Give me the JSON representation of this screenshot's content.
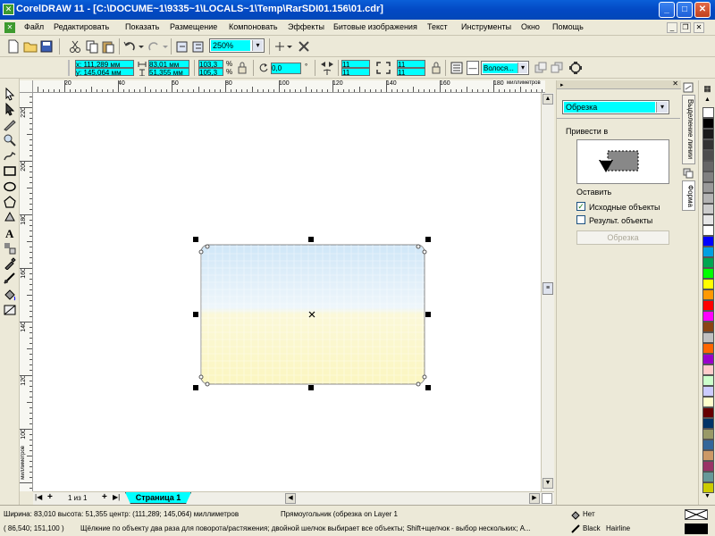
{
  "window": {
    "title": "CorelDRAW 11 - [C:\\DOCUME~1\\9335~1\\LOCALS~1\\Temp\\RarSDI01.156\\01.cdr]"
  },
  "menu": [
    "Файл",
    "Редактировать",
    "Показать",
    "Размещение",
    "Компоновать",
    "Эффекты",
    "Битовые изображения",
    "Текст",
    "Инструменты",
    "Окно",
    "Помощь"
  ],
  "toolbar": {
    "zoom": "250%"
  },
  "propbar": {
    "x": "x: 111,289 мм",
    "y": "y: 145,064 мм",
    "width": "83,01 мм",
    "height": "51,355 мм",
    "scale_x": "103,3",
    "scale_y": "105,3",
    "pct1": "%",
    "pct2": "%",
    "rotation": "0,0",
    "deg": "°",
    "corner1": "11",
    "corner2": "11",
    "corner3": "11",
    "corner4": "11",
    "outline": "Волося..."
  },
  "ruler": {
    "h_labels": [
      "20",
      "40",
      "60",
      "80",
      "100",
      "120",
      "140",
      "160",
      "180"
    ],
    "h_unit": "миллиметров",
    "v_labels": [
      "220",
      "200",
      "180",
      "160",
      "140",
      "120",
      "100"
    ],
    "v_unit": "миллиметров"
  },
  "pages": {
    "count": "1 из 1",
    "tab": "Страница 1"
  },
  "docker": {
    "mode": "Обрезка",
    "target_label": "Привести в",
    "leave_label": "Оставить",
    "opt_source": "Исходные объекты",
    "opt_result": "Результ. объекты",
    "apply_button": "Обрезка",
    "tab1": "Выделение линии",
    "tab2": "Форма"
  },
  "status": {
    "line1": "Ширина: 83,010  высота: 51,355  центр: (111,289; 145,064)  миллиметров",
    "object": "Прямоугольник (обрезка on Layer 1",
    "coords": "( 86,540; 151,100 )",
    "hint": "Щёлкние по объекту два раза для поворота/растяжения; двойной шелчок выбирает все объекты; Shift+щелчок - выбор нескольких; A...",
    "fill": "Нет",
    "outline_color": "Black",
    "outline_width": "Hairline"
  },
  "palette_colors": [
    "#ffffff",
    "#000000",
    "#1a1a1a",
    "#333333",
    "#4d4d4d",
    "#666666",
    "#808080",
    "#999999",
    "#b3b3b3",
    "#cccccc",
    "#e6e6e6",
    "#ffffff",
    "#0000ff",
    "#00a0e0",
    "#00a650",
    "#00ff00",
    "#ffff00",
    "#ff9900",
    "#ff0000",
    "#ff00ff",
    "#8b4513",
    "#c0c0c0",
    "#ff6600",
    "#9900cc",
    "#ffcccc",
    "#ccffcc",
    "#ccccff",
    "#ffffcc",
    "#660000",
    "#003366",
    "#999966",
    "#336699",
    "#cc9966",
    "#993366",
    "#669999",
    "#cccc00",
    "#996633",
    "#ccccff"
  ]
}
